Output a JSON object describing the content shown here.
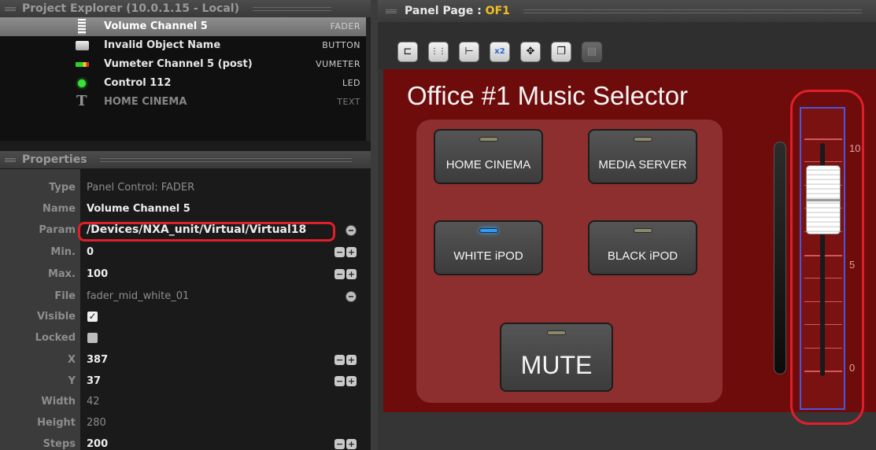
{
  "explorer": {
    "title": "Project Explorer (10.0.1.15 - Local)",
    "rows": [
      {
        "label": "Volume Channel 5",
        "kind": "FADER",
        "icon": "fader-icon",
        "selected": true
      },
      {
        "label": "Invalid Object Name",
        "kind": "BUTTON",
        "icon": "button-icon"
      },
      {
        "label": "Vumeter Channel 5 (post)",
        "kind": "VUMETER",
        "icon": "vumeter-icon"
      },
      {
        "label": "Control 112",
        "kind": "LED",
        "icon": "led-icon"
      },
      {
        "label": "HOME CINEMA",
        "kind": "TEXT",
        "icon": "text-icon"
      }
    ]
  },
  "properties": {
    "title": "Properties",
    "rows": [
      {
        "key": "Type",
        "value": "Panel Control: FADER"
      },
      {
        "key": "Name",
        "value": "Volume Channel 5"
      },
      {
        "key": "Param",
        "value": "/Devices/NXA_unit/Virtual/Virtual18"
      },
      {
        "key": "Min.",
        "value": "0"
      },
      {
        "key": "Max.",
        "value": "100"
      },
      {
        "key": "File",
        "value": "fader_mid_white_01"
      },
      {
        "key": "Visible",
        "value": "✓"
      },
      {
        "key": "Locked",
        "value": ""
      },
      {
        "key": "X",
        "value": "387"
      },
      {
        "key": "Y",
        "value": "37"
      },
      {
        "key": "Width",
        "value": "42"
      },
      {
        "key": "Height",
        "value": "280"
      },
      {
        "key": "Steps",
        "value": "200"
      }
    ],
    "stepper_minus": "−",
    "stepper_plus": "+"
  },
  "panel_page": {
    "label": "Panel Page : ",
    "name": "OF1",
    "toolbar": [
      {
        "icon": "ruler-icon",
        "glyph": "⊏"
      },
      {
        "icon": "grid-icon",
        "glyph": "⋮⋮"
      },
      {
        "icon": "align-icon",
        "glyph": "⊢"
      },
      {
        "icon": "zoom-x2-icon",
        "glyph": "x2"
      },
      {
        "icon": "move-icon",
        "glyph": "✥"
      },
      {
        "icon": "copy-icon",
        "glyph": "❐"
      },
      {
        "icon": "paste-icon",
        "glyph": "▤",
        "disabled": true
      }
    ]
  },
  "canvas": {
    "title": "Office #1 Music Selector",
    "buttons": {
      "home_cinema": "HOME CINEMA",
      "media_server": "MEDIA SERVER",
      "white_ipod": "WHITE iPOD",
      "black_ipod": "BLACK iPOD",
      "mute": "MUTE"
    },
    "fader_scale": {
      "top": "10",
      "mid": "5",
      "bottom": "0"
    },
    "fader_level_fraction": 0.85,
    "colors": {
      "background": "#6e0b0b",
      "button_group": "#8e2f2f",
      "led_on": "#2a9cff",
      "highlight": "#e01f2a"
    }
  }
}
